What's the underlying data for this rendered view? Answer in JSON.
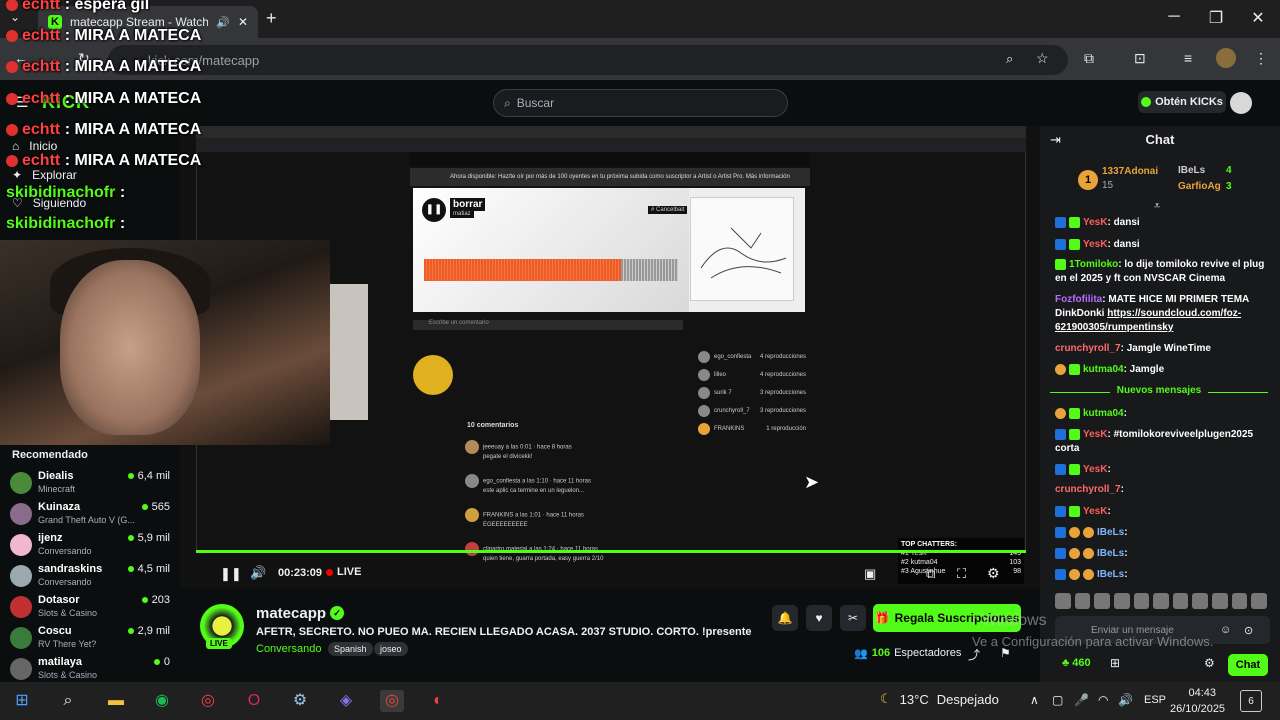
{
  "browser": {
    "tab_title": "matecapp Stream - Watch L",
    "url": "kick.com/matecapp",
    "new_tab": "+",
    "minimize": "─",
    "maximize": "❐",
    "close": "✕"
  },
  "header": {
    "search_placeholder": "Buscar",
    "kicks_label": "Obtén KICKs"
  },
  "sidebar": {
    "nav": [
      {
        "label": "Inicio"
      },
      {
        "label": "Explorar"
      },
      {
        "label": "Siguiendo"
      }
    ],
    "recommended_title": "Recomendado",
    "recommended": [
      {
        "name": "Diealis",
        "category": "Minecraft",
        "viewers": "6,4 mil"
      },
      {
        "name": "Kuinaza",
        "category": "Grand Theft Auto V (G...",
        "viewers": "565"
      },
      {
        "name": "ijenz",
        "category": "Conversando",
        "viewers": "5,9 mil"
      },
      {
        "name": "sandraskins",
        "category": "Conversando",
        "viewers": "4,5 mil"
      },
      {
        "name": "Dotasor",
        "category": "Slots & Casino",
        "viewers": "203"
      },
      {
        "name": "Coscu",
        "category": "RV There Yet?",
        "viewers": "2,9 mil"
      },
      {
        "name": "matilaya",
        "category": "Slots & Casino",
        "viewers": "0"
      }
    ]
  },
  "overlay_chat": [
    {
      "user": "echtt",
      "text": ": espera gil"
    },
    {
      "user": "echtt",
      "text": ": MIRA A MATECA"
    },
    {
      "user": "echtt",
      "text": ": MIRA A MATECA"
    },
    {
      "user": "echtt",
      "text": ": MIRA A MATECA"
    },
    {
      "user": "echtt",
      "text": ": MIRA A MATECA"
    },
    {
      "user": "echtt",
      "text": ": MIRA A MATECA"
    },
    {
      "user": "skibidinachofr",
      "text": ":"
    },
    {
      "user": "skibidinachofr",
      "text": ":"
    }
  ],
  "stream_content": {
    "track_title": "borrar",
    "track_artist": "matiaz",
    "tag": "# Cancelbait",
    "notice": "Ahora disponible: Haz/te oír por más de 100 oyentes en tu próxima subida como suscriptor a Artist o Artist Pro.  Más información",
    "comments_header": "10 comentarios",
    "comments": [
      {
        "user": "jeeeuay a las 0:01 · hace 8 horas",
        "text": "pegate el divicekk!"
      },
      {
        "user": "ego_confiesta a las 1:10 · hace 11 horas",
        "text": "este aplic ca termine en un leguelon..."
      },
      {
        "user": "FRANKINS a las 1:01 · hace 11 horas",
        "text": "EGEEEEEEEEE"
      },
      {
        "user": "clipartro material a las 1:24 · hace 11 horas",
        "text": "quien tiene, guarra portada, easy guerra 2/10"
      }
    ],
    "likes_list": [
      {
        "name": "ego_confiesta",
        "count": "4 reproducciones"
      },
      {
        "name": "lilleo",
        "count": "4 reproducciones"
      },
      {
        "name": "surik 7",
        "count": "3 reproducciones"
      },
      {
        "name": "crunchyroll_7",
        "count": "3 reproducciones"
      },
      {
        "name": "FRANKINS",
        "count": "1 reproducción"
      }
    ],
    "top_chatters_title": "TOP CHATTERS:",
    "top_chatters": [
      {
        "name": "#1 YesK",
        "count": "145"
      },
      {
        "name": "#2 kutma04",
        "count": "103"
      },
      {
        "name": "#3 Agustinhue",
        "count": "98"
      }
    ]
  },
  "player": {
    "time": "00:23:09",
    "live_label": "LIVE",
    "progress": 1.0
  },
  "channel": {
    "name": "matecapp",
    "live_badge": "LIVE",
    "title": "AFETR, SECRETO. NO PUEO MA. RECIEN LLEGADO ACASA. 2037 STUDIO. CORTO.    !presente",
    "category": "Conversando",
    "tags": [
      "Spanish",
      "joseo"
    ],
    "gift_label": "Regala Suscripciones",
    "viewers": "106",
    "viewers_label": "Espectadores"
  },
  "chat": {
    "title": "Chat",
    "pinned": {
      "first": {
        "name": "1337Adonai",
        "count": "15"
      },
      "second": {
        "name": "IBeLs",
        "count": "4"
      },
      "third": {
        "name": "GarfioAg",
        "count": "3"
      }
    },
    "messages": [
      {
        "user": "YesK",
        "text": ": dansi",
        "color": "#ff5e5e"
      },
      {
        "user": "YesK",
        "text": ": dansi",
        "color": "#ff5e5e"
      },
      {
        "user": "1Tomiloko",
        "text": ": lo dije tomiloko revive el plug en el 2025 y ft con NVSCAR Cinema",
        "color": "#53fc18"
      },
      {
        "user": "Fozfofilita",
        "text": ": MATE HICE MI PRIMER TEMA DinkDonki ",
        "link": "https://soundcloud.com/foz-621900305/rumpentinsky",
        "color": "#b56bff"
      },
      {
        "user": "crunchyroll_7",
        "text": ": Jamgle WineTime",
        "color": "#ff6b6b"
      },
      {
        "user": "kutma04",
        "text": ": Jamgle",
        "color": "#53fc18"
      },
      {
        "user": "kutma04",
        "text": ":",
        "color": "#53fc18"
      },
      {
        "user": "YesK",
        "text": ": #tomilokoreviveelplugen2025 corta",
        "color": "#ff5e5e"
      },
      {
        "user": "YesK",
        "text": ":",
        "color": "#ff5e5e"
      },
      {
        "user": "crunchyroll_7",
        "text": ":",
        "color": "#ff6b6b"
      },
      {
        "user": "YesK",
        "text": ":",
        "color": "#ff5e5e"
      },
      {
        "user": "IBeLs",
        "text": ":",
        "color": "#7fb6ff"
      },
      {
        "user": "IBeLs",
        "text": ":",
        "color": "#7fb6ff"
      },
      {
        "user": "IBeLs",
        "text": ":",
        "color": "#7fb6ff"
      }
    ],
    "new_messages": "Nuevos mensajes",
    "input_placeholder": "Enviar un mensaje",
    "points": "460",
    "send_label": "Chat"
  },
  "watermark": {
    "line1": "r Windows",
    "line2": "Ve a Configuración para activar Windows."
  },
  "taskbar": {
    "temperature": "13°C",
    "weather": "Despejado",
    "lang": "ESP",
    "time": "04:43",
    "date": "26/10/2025",
    "notifications": "6"
  },
  "colors": {
    "accent": "#53fc18",
    "background": "#0b0e0f",
    "chat_bg": "#18191b"
  }
}
